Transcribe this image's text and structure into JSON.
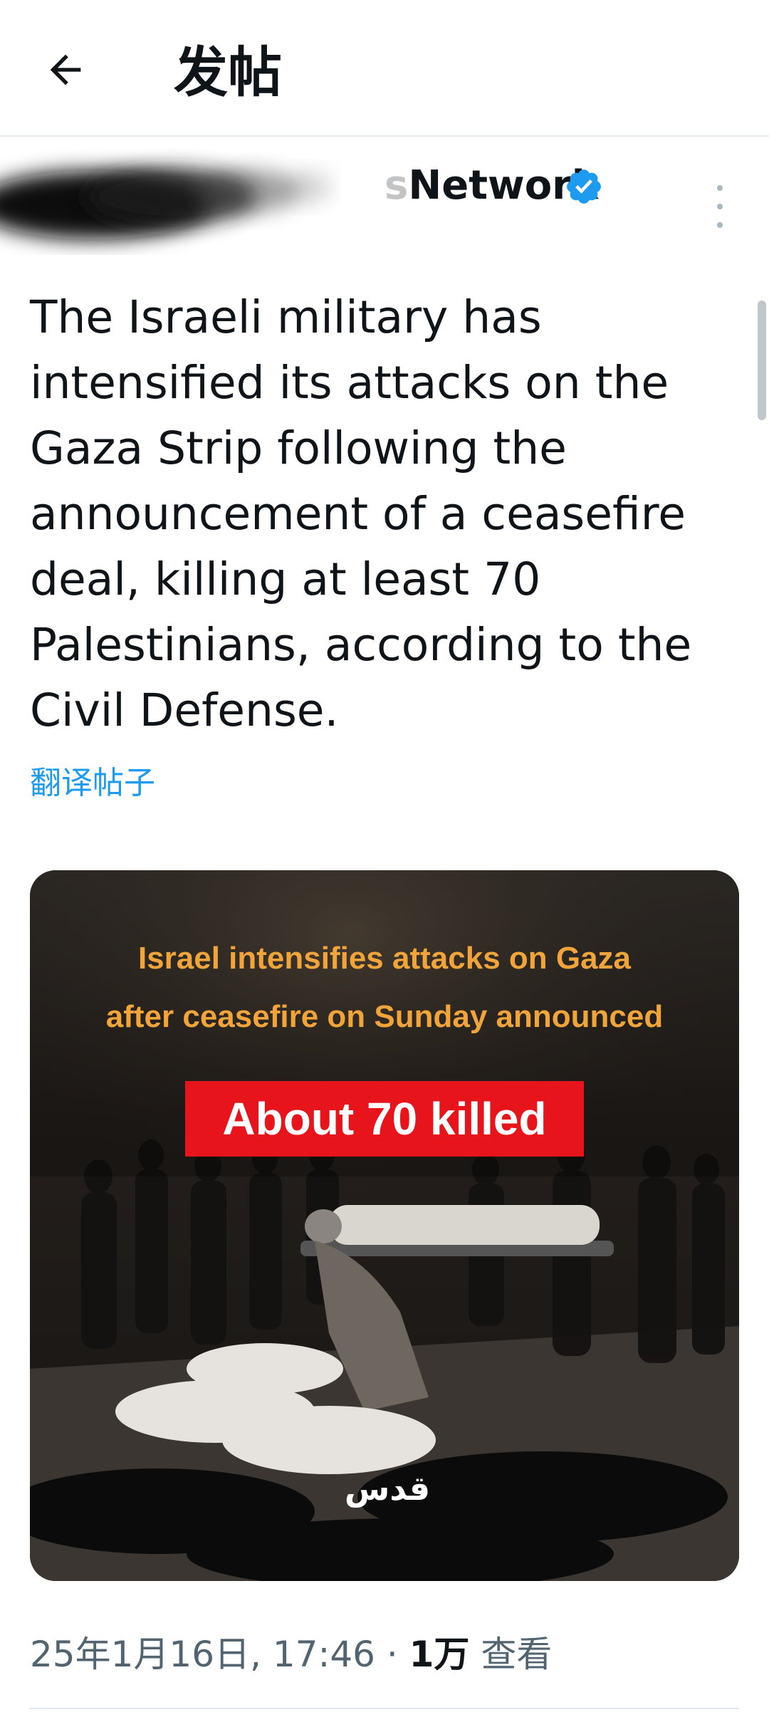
{
  "header": {
    "title": "发帖"
  },
  "author": {
    "name_visible": "Network",
    "name_faded": "s"
  },
  "post": {
    "text": "The Israeli military has intensified its attacks on the Gaza Strip following the announcement of a ceasefire deal, killing at least 70 Palestinians, according to the Civil Defense.",
    "translate_label": "翻译帖子"
  },
  "media": {
    "headline_line1": "Israel intensifies attacks on Gaza",
    "headline_line2": "after ceasefire on Sunday announced",
    "banner": "About 70 killed",
    "logo_text": "قدس"
  },
  "meta": {
    "timestamp": "25年1月16日, 17:46",
    "separator": " · ",
    "views_count": "1万",
    "views_label": " 查看"
  },
  "colors": {
    "accent": "#1d9bf0",
    "headline_orange": "#f0a43a",
    "banner_red": "#e8141c",
    "text_primary": "#0f1419",
    "text_secondary": "#536471"
  }
}
